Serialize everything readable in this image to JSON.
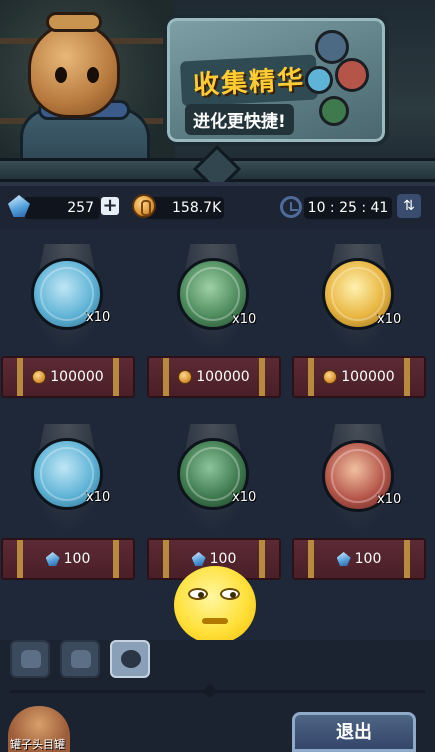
{
  "banner": {
    "title": "收集精华",
    "subtitle": "进化更快捷!"
  },
  "currency": {
    "gems": "257",
    "coins": "158.7K",
    "timer": "10 : 25 : 41",
    "add_symbol": "+",
    "refresh_symbol": "⇅"
  },
  "shop": {
    "row1": [
      {
        "name": "ice-sword-essence",
        "qty": "x10",
        "price": "100000",
        "currency": "coin",
        "color": "#5fb3d6"
      },
      {
        "name": "green-dragon-essence",
        "qty": "x10",
        "price": "100000",
        "currency": "coin",
        "color": "#4c8a5c"
      },
      {
        "name": "golden-crown-essence",
        "qty": "x10",
        "price": "100000",
        "currency": "coin",
        "color": "#e8b540"
      }
    ],
    "row2": [
      {
        "name": "ice-sword-essence",
        "qty": "x10",
        "price": "100",
        "currency": "gem",
        "color": "#5fb3d6"
      },
      {
        "name": "green-hood-essence",
        "qty": "x10",
        "price": "100",
        "currency": "gem",
        "color": "#3f7a4f"
      },
      {
        "name": "lion-beast-essence",
        "qty": "x10",
        "price": "100",
        "currency": "gem",
        "color": "#b5554a"
      }
    ]
  },
  "bottom": {
    "exit_label": "退出",
    "avatar_label": "罐子头目罐"
  }
}
